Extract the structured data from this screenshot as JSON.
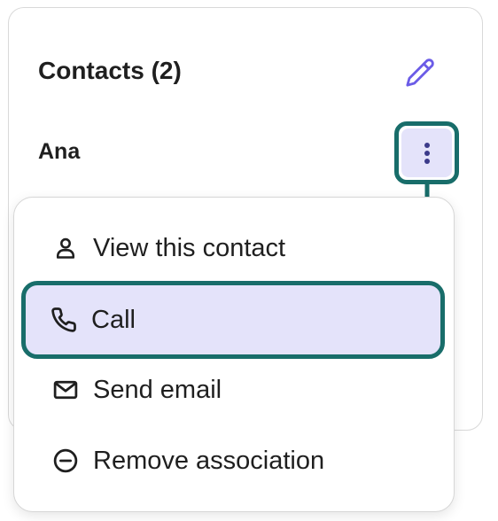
{
  "card": {
    "title": "Contacts (2)",
    "edit_icon": "pencil-icon",
    "contact_name": "Ana",
    "more_icon": "more-vertical-icon"
  },
  "menu": {
    "items": [
      {
        "label": "View this contact",
        "icon": "user-icon"
      },
      {
        "label": "Call",
        "icon": "phone-icon",
        "highlighted": true
      },
      {
        "label": "Send email",
        "icon": "mail-icon"
      },
      {
        "label": "Remove association",
        "icon": "minus-circle-icon"
      }
    ]
  },
  "colors": {
    "accent": "#6b5ce7",
    "highlight_bg": "#e4e3fa",
    "callout": "#186d6a",
    "text": "#1f1f1f",
    "border": "#d9d9d9"
  }
}
